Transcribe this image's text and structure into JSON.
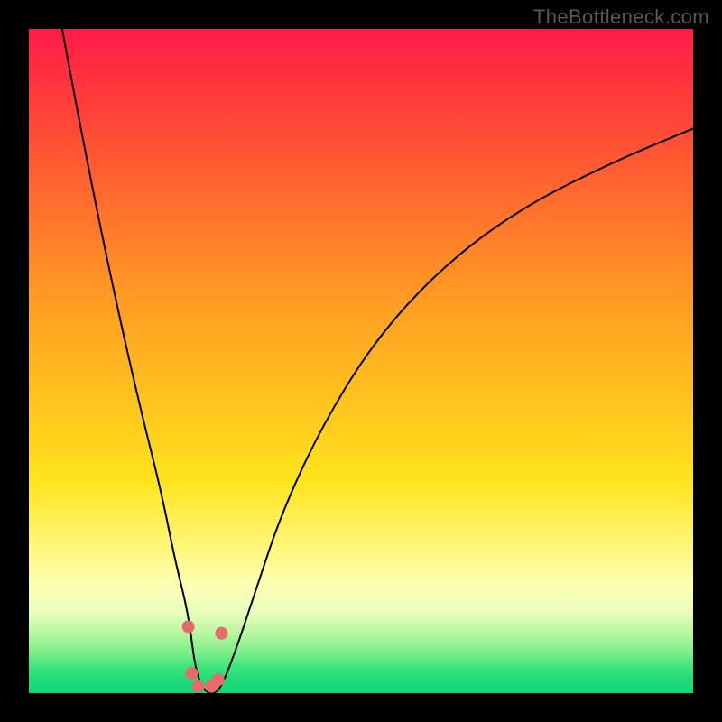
{
  "watermark": "TheBottleneck.com",
  "colors": {
    "frame_bg": "#000000",
    "gradient_top": "#ff1b4a",
    "gradient_bottom": "#14d677",
    "curve_stroke": "#000000",
    "marker_fill": "#e86a6a"
  },
  "chart_data": {
    "type": "line",
    "title": "",
    "xlabel": "",
    "ylabel": "",
    "xlim": [
      0,
      100
    ],
    "ylim": [
      0,
      100
    ],
    "grid": false,
    "legend": false,
    "series": [
      {
        "name": "bottleneck-curve",
        "x": [
          5,
          8,
          11,
          14,
          17,
          20,
          22,
          24,
          25,
          26,
          27,
          28,
          29,
          31,
          34,
          38,
          44,
          52,
          62,
          74,
          88,
          100
        ],
        "y": [
          100,
          84,
          69,
          55,
          42,
          30,
          20,
          12,
          4,
          1,
          0,
          0,
          1,
          6,
          15,
          27,
          40,
          53,
          64,
          73,
          80,
          85
        ]
      }
    ],
    "markers": [
      {
        "x": 24.0,
        "y": 10
      },
      {
        "x": 24.5,
        "y": 3
      },
      {
        "x": 25.5,
        "y": 1
      },
      {
        "x": 27.5,
        "y": 1
      },
      {
        "x": 28.5,
        "y": 2
      },
      {
        "x": 29.0,
        "y": 9
      }
    ]
  }
}
